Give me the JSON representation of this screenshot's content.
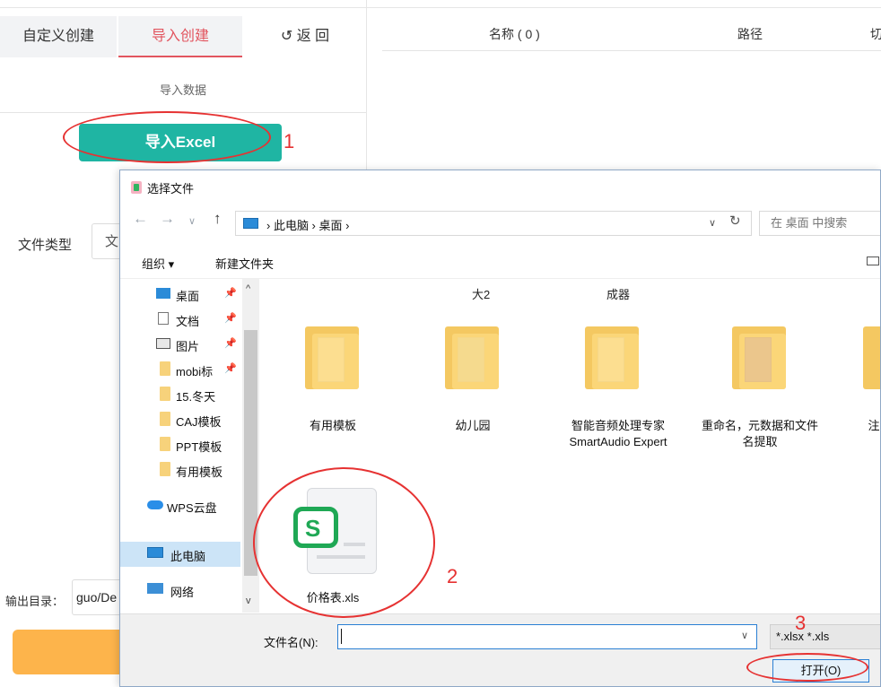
{
  "app": {
    "tabs": [
      "自定义创建",
      "导入创建",
      "↺ 返  回"
    ],
    "section_label": "导入数据",
    "import_button": "导入Excel",
    "table_headers": [
      "名称 ( 0 )",
      "路径",
      "切"
    ],
    "file_type_label": "文件类型",
    "file_type_value": "文",
    "output_label": "输出目录：",
    "output_value": "guo/De"
  },
  "dialog": {
    "title": "选择文件",
    "address": "› 此电脑 › 桌面 ›",
    "search_placeholder": "在 桌面 中搜索",
    "toolbar": {
      "organize": "组织 ▾",
      "new_folder": "新建文件夹"
    },
    "nav_items": [
      {
        "label": "桌面",
        "pinned": true,
        "icon": "desktop-icon"
      },
      {
        "label": "文档",
        "pinned": true,
        "icon": "document-icon"
      },
      {
        "label": "图片",
        "pinned": true,
        "icon": "picture-icon"
      },
      {
        "label": "mobi标",
        "pinned": true,
        "icon": "folder-icon"
      },
      {
        "label": "15.冬天",
        "pinned": false,
        "icon": "folder-icon"
      },
      {
        "label": "CAJ模板",
        "pinned": false,
        "icon": "folder-icon"
      },
      {
        "label": "PPT模板",
        "pinned": false,
        "icon": "folder-icon"
      },
      {
        "label": "有用模板",
        "pinned": false,
        "icon": "folder-icon"
      },
      {
        "label": "WPS云盘",
        "pinned": false,
        "icon": "cloud-icon"
      },
      {
        "label": "此电脑",
        "pinned": false,
        "icon": "computer-icon",
        "selected": true
      },
      {
        "label": "网络",
        "pinned": false,
        "icon": "network-icon"
      }
    ],
    "top_partial_labels": [
      "大2",
      "成器"
    ],
    "files": [
      {
        "name": "有用模板",
        "type": "folder"
      },
      {
        "name": "幼儿园",
        "type": "folder"
      },
      {
        "name": "智能音频处理专家 SmartAudio Expert",
        "type": "folder"
      },
      {
        "name": "重命名，元数据和文件名提取",
        "type": "folder"
      },
      {
        "name": "注",
        "type": "folder"
      },
      {
        "name": "价格表.xls",
        "type": "wps-spreadsheet"
      }
    ],
    "filename_label": "文件名(N):",
    "filename_value": "",
    "filter": "*.xlsx *.xls",
    "open_button": "打开(O)"
  },
  "annotations": [
    "1",
    "2",
    "3"
  ],
  "colors": {
    "accent_red": "#e2555f",
    "import_button": "#1fb5a3",
    "annotation": "#e63232",
    "orange_button": "#fdb44b"
  }
}
